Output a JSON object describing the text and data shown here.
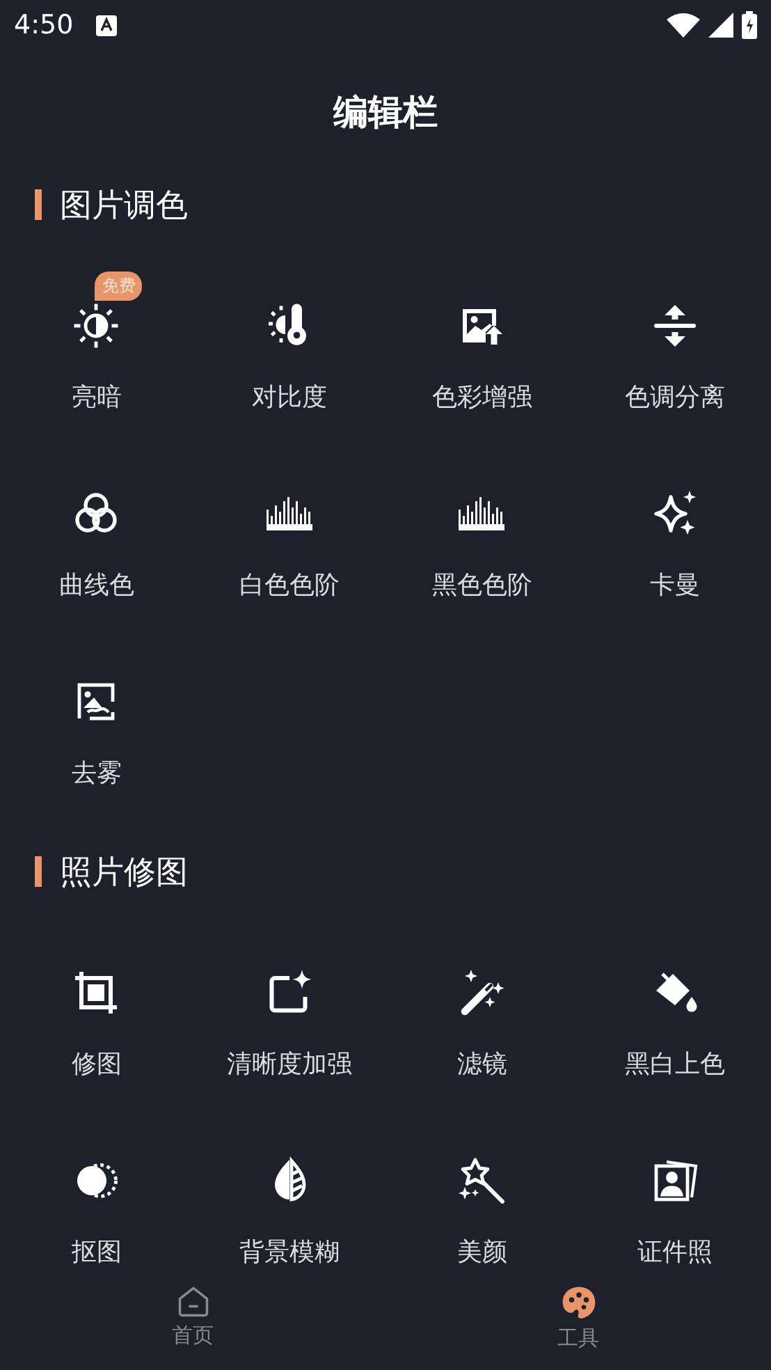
{
  "status_bar": {
    "time": "4:50"
  },
  "title": "编辑栏",
  "sections": [
    {
      "heading": "图片调色",
      "items": [
        {
          "label": "亮暗",
          "badge": "免费"
        },
        {
          "label": "对比度"
        },
        {
          "label": "色彩增强"
        },
        {
          "label": "色调分离"
        },
        {
          "label": "曲线色"
        },
        {
          "label": "白色色阶"
        },
        {
          "label": "黑色色阶"
        },
        {
          "label": "卡曼"
        },
        {
          "label": "去雾"
        }
      ]
    },
    {
      "heading": "照片修图",
      "items": [
        {
          "label": "修图"
        },
        {
          "label": "清晰度加强"
        },
        {
          "label": "滤镜"
        },
        {
          "label": "黑白上色"
        },
        {
          "label": "抠图"
        },
        {
          "label": "背景模糊"
        },
        {
          "label": "美颜"
        },
        {
          "label": "证件照"
        }
      ]
    }
  ],
  "bottom_nav": [
    {
      "label": "首页",
      "selected": false
    },
    {
      "label": "工具",
      "selected": true
    }
  ]
}
